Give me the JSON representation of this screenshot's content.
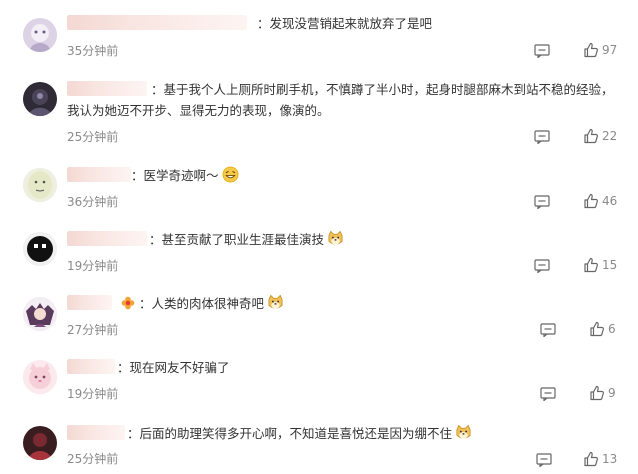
{
  "comments": [
    {
      "text": "：发现没营销起来就放弃了是吧",
      "time": "35分钟前",
      "likes": "97",
      "emoji": ""
    },
    {
      "text": "：基于我个人上厕所时刷手机，不慎蹲了半小时，起身时腿部麻木到站不稳的经验，我认为她迈不开步、显得无力的表现，像演的。",
      "time": "25分钟前",
      "likes": "22",
      "emoji": ""
    },
    {
      "text": "：医学奇迹啊～",
      "time": "36分钟前",
      "likes": "46",
      "emoji": "laughing-emoji"
    },
    {
      "text": "：甚至贡献了职业生涯最佳演技",
      "time": "19分钟前",
      "likes": "15",
      "emoji": "doge-emoji"
    },
    {
      "text": "：人类的肉体很神奇吧",
      "time": "27分钟前",
      "likes": "6",
      "emoji": "doge-emoji"
    },
    {
      "text": "：现在网友不好骗了",
      "time": "19分钟前",
      "likes": "9",
      "emoji": ""
    },
    {
      "text": "：后面的助理笑得多开心啊，不知道是喜悦还是因为绷不住",
      "time": "25分钟前",
      "likes": "13",
      "emoji": "doge-emoji"
    }
  ],
  "icons": {
    "reply": "comment-icon",
    "like": "thumbs-up-icon"
  },
  "colors": {
    "meta": "#8a8a8a",
    "text": "#333333",
    "name_blur": "#f3d6d0"
  }
}
